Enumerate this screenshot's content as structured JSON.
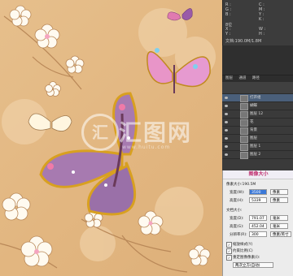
{
  "watermark": {
    "name": "汇图网",
    "url": "www.huitu.com"
  },
  "info_panel": {
    "rows": [
      "R :",
      "G :",
      "B :",
      "C :",
      "M :",
      "Y :",
      "K :",
      "8位",
      "X :",
      "Y :",
      "W :",
      "H :",
      "文档:190.0M/1.8M"
    ],
    "values": [
      "",
      "",
      "",
      "",
      "",
      "",
      "",
      "",
      "",
      "",
      "",
      "",
      ""
    ]
  },
  "layers_panel": {
    "tabs": [
      "图层",
      "通道",
      "路径"
    ],
    "layers": [
      {
        "name": "打开组"
      },
      {
        "name": "蝴蝶"
      },
      {
        "name": "图层 12"
      },
      {
        "name": "花"
      },
      {
        "name": "背景"
      },
      {
        "name": "图层"
      },
      {
        "name": "图层 1"
      },
      {
        "name": "图层 2"
      }
    ]
  },
  "image_size_dialog": {
    "title": "图像大小",
    "pixel_size_label": "像素大小:190.5M",
    "width_label": "宽度(W):",
    "width_value": "3500",
    "height_label": "高度(H):",
    "height_value": "5339",
    "unit_px": "像素",
    "doc_size_label": "文档大小:",
    "doc_width_label": "宽度(D):",
    "doc_width_value": "791.07",
    "doc_height_label": "高度(G):",
    "doc_height_value": "452.04",
    "unit_mm": "毫米",
    "res_label": "分辨率(R):",
    "res_value": "300",
    "res_unit": "像素/英寸",
    "scale_styles": "缩放样式(Y)",
    "constrain": "约束比例(C)",
    "resample": "重定图像像素(I):",
    "resample_method": "两次立方(自动)"
  }
}
